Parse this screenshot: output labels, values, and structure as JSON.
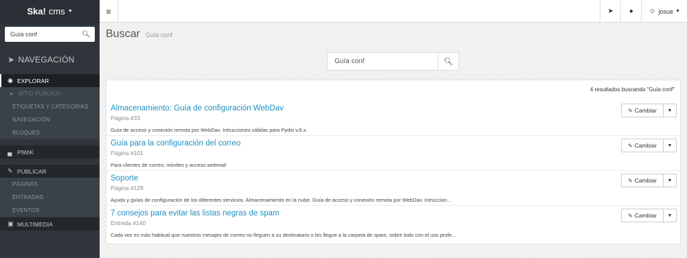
{
  "brand": {
    "logo": "Ska!",
    "name": "cms"
  },
  "sidebar": {
    "search_value": "Guía conf",
    "nav_title": "NAVEGACIÓN",
    "sections": [
      {
        "label": "EXPLORAR",
        "items": [
          "SITIO PÚBLICO",
          "ETIQUETAS Y CATEGORÍAS",
          "NAVEGACIÓN",
          "BLOQUES"
        ]
      },
      {
        "label": "PIWIK"
      },
      {
        "label": "PUBLICAR",
        "items": [
          "PÁGINAS",
          "ENTRADAS",
          "EVENTOS"
        ]
      },
      {
        "label": "MULTIMEDIA"
      }
    ]
  },
  "topbar": {
    "user": "josue"
  },
  "page": {
    "title": "Buscar",
    "subtitle": "Guía conf",
    "search_value": "Guía conf",
    "results_count": "4 resultados buscando \"Guía conf\"",
    "change_label": "Cambiar",
    "results": [
      {
        "title": "Almacenamiento: Guía de configuración WebDav",
        "type": "Página #33",
        "desc": "Guía de acceso y conexión remota por WebDav. Intrucciones válidas para Pydio v.6.x."
      },
      {
        "title": "Guía para la configuración del correo",
        "type": "Página #101",
        "desc": "Para clientes de correo, móviles y acceso webmail"
      },
      {
        "title": "Soporte",
        "type": "Página #128",
        "desc": "Ayuda y guías de configuración de los diferentes servicios. Almacenamiento en la nube. Guía de acceso y conexión remota por WebDav. Intruccion..."
      },
      {
        "title": "7 consejos para evitar las listas negras de spam",
        "type": "Entrada #140",
        "desc": "Cada vez es más habitual que nuestros mesajes de correo no lleguen a su destinatario o les llegue a la carpeta de spam, sobre todo con el uso profe..."
      }
    ]
  },
  "icons": {
    "search": "search-icon",
    "rocket": "rocket-icon",
    "explore": "compass-icon",
    "globe": "globe-icon",
    "chart": "chart-icon",
    "pencil": "pencil-icon",
    "media": "image-icon",
    "menu": "hamburger-icon",
    "send": "paper-plane-icon",
    "chat": "chat-bubble-icon",
    "user": "user-icon"
  }
}
